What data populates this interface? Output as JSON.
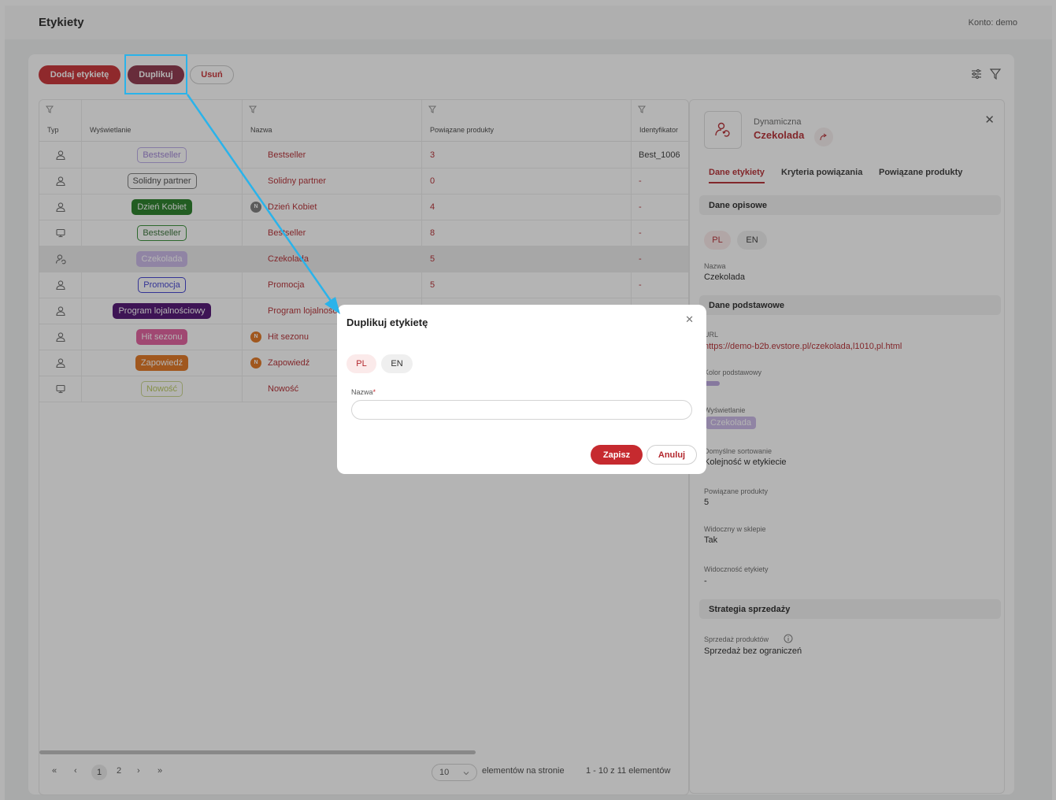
{
  "app": {
    "title": "Etykiety",
    "account": "Konto: demo"
  },
  "toolbar": {
    "add_label": "Dodaj etykietę",
    "duplicate_label": "Duplikuj",
    "delete_label": "Usuń"
  },
  "table": {
    "columns": [
      "Typ",
      "Wyświetlanie",
      "Nazwa",
      "Powiązane produkty",
      "Identyfikator"
    ],
    "rows": [
      {
        "type": "user-icon",
        "display": "Bestseller",
        "name": "Bestseller",
        "products": "3",
        "id": "Best_1006"
      },
      {
        "type": "user-icon",
        "display": "Solidny partner",
        "name": "Solidny partner",
        "products": "0",
        "id": "-"
      },
      {
        "type": "user-icon",
        "display": "Dzień Kobiet",
        "name": "Dzień Kobiet",
        "badge": "N",
        "products": "4",
        "id": "-"
      },
      {
        "type": "monitor-icon",
        "display": "Bestseller",
        "name": "Bestseller",
        "products": "8",
        "id": "-"
      },
      {
        "type": "user-dynamic-icon",
        "display": "Czekolada",
        "name": "Czekolada",
        "products": "5",
        "id": "-"
      },
      {
        "type": "user-icon",
        "display": "Promocja",
        "name": "Promocja",
        "products": "5",
        "id": "-"
      },
      {
        "type": "user-icon",
        "display": "Program lojalnościowy",
        "name": "Program lojalnościowy",
        "products": "",
        "id": ""
      },
      {
        "type": "user-icon",
        "display": "Hit sezonu",
        "name": "Hit sezonu",
        "badge": "N",
        "products": "",
        "id": ""
      },
      {
        "type": "user-icon",
        "display": "Zapowiedź",
        "name": "Zapowiedź",
        "badge": "N",
        "products": "",
        "id": ""
      },
      {
        "type": "monitor-icon",
        "display": "Nowość",
        "name": "Nowość",
        "products": "",
        "id": ""
      }
    ]
  },
  "pagination": {
    "first": "«",
    "prev": "‹",
    "pages": [
      "1",
      "2"
    ],
    "next": "›",
    "last": "»",
    "per_page": "10",
    "per_page_label": "elementów na stronie",
    "range": "1 - 10 z 11 elementów"
  },
  "detail": {
    "kind": "Dynamiczna",
    "name": "Czekolada",
    "tabs": [
      "Dane etykiety",
      "Kryteria powiązania",
      "Powiązane produkty"
    ],
    "sections": {
      "descriptive": "Dane opisowe",
      "basic": "Dane podstawowe",
      "strategy": "Strategia sprzedaży"
    },
    "langs": [
      "PL",
      "EN"
    ],
    "fields": {
      "name_label": "Nazwa",
      "name_value": "Czekolada",
      "url_label": "URL",
      "url_value": "https://demo-b2b.evstore.pl/czekolada,l1010,pl.html",
      "color_label": "Kolor podstawowy",
      "display_label": "Wyświetlanie",
      "display_value": "Czekolada",
      "sort_label": "Domyślne sortowanie",
      "sort_value": "Kolejność w etykiecie",
      "products_label": "Powiązane produkty",
      "products_value": "5",
      "visible_label": "Widoczny w sklepie",
      "visible_value": "Tak",
      "label_visibility_label": "Widoczność etykiety",
      "label_visibility_value": "-",
      "sales_label": "Sprzedaż produktów",
      "sales_value": "Sprzedaż bez ograniczeń"
    }
  },
  "modal": {
    "title": "Duplikuj etykietę",
    "langs": [
      "PL",
      "EN"
    ],
    "field_label": "Nazwa",
    "required_mark": "*",
    "field_value": "",
    "save_label": "Zapisz",
    "cancel_label": "Anuluj"
  },
  "colors": {
    "accent": "#c62a2f",
    "duplicate": "#8a2f45",
    "highlight": "#2ab3ea",
    "tags": {
      "Bestseller-outline": "#9b7fd4",
      "Solidny partner": "#555555",
      "Dzień Kobiet": "#1f7a1f",
      "Bestseller-green": "#2e8b2e",
      "Czekolada": "#b8a3de",
      "Promocja": "#3a3ad0",
      "Program lojalnościowy": "#4a0a6e",
      "Hit sezonu": "#e05a9a",
      "Zapowiedź": "#e0701a",
      "Nowość": "#b8c85a"
    }
  }
}
